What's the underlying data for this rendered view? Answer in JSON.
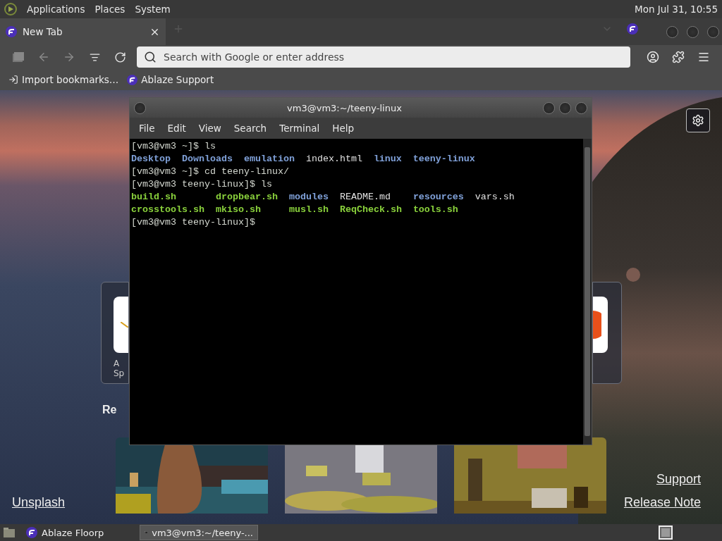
{
  "top_panel": {
    "menus": [
      "Applications",
      "Places",
      "System"
    ],
    "clock": "Mon Jul 31, 10:55"
  },
  "browser": {
    "tabs": [
      {
        "title": "New Tab",
        "selected": true
      }
    ],
    "address_bar": {
      "placeholder": "Search with Google or enter address"
    },
    "bookmarks": [
      {
        "label": "Import bookmarks…",
        "kind": "import"
      },
      {
        "label": "Ablaze Support",
        "kind": "site"
      }
    ]
  },
  "new_tab_page": {
    "shortcuts": [
      {
        "kind": "pen",
        "label_lines": [
          "A",
          "Sp"
        ]
      },
      {
        "kind": "orange"
      }
    ],
    "section_heading": "Re",
    "photos": [
      {
        "kind": "dog"
      },
      {
        "kind": "plates"
      },
      {
        "kind": "room"
      }
    ],
    "links_left": [
      "Unsplash"
    ],
    "links_right": [
      "Support",
      "Release Note"
    ]
  },
  "terminal": {
    "title": "vm3@vm3:~/teeny-linux",
    "menu": [
      "File",
      "Edit",
      "View",
      "Search",
      "Terminal",
      "Help"
    ],
    "lines": [
      {
        "kind": "command",
        "text": "[vm3@vm3 ~]$ ls"
      },
      {
        "kind": "listing",
        "rows": [
          [
            {
              "name": "Desktop",
              "kind": "dir"
            },
            {
              "name": "Downloads",
              "kind": "dir"
            },
            {
              "name": "emulation",
              "kind": "dir"
            },
            {
              "name": "index.html",
              "kind": "file"
            },
            {
              "name": "linux",
              "kind": "dir"
            },
            {
              "name": "teeny-linux",
              "kind": "dir"
            }
          ]
        ]
      },
      {
        "kind": "command",
        "text": "[vm3@vm3 ~]$ cd teeny-linux/"
      },
      {
        "kind": "command",
        "text": "[vm3@vm3 teeny-linux]$ ls"
      },
      {
        "kind": "listing",
        "rows": [
          [
            {
              "name": "build.sh",
              "kind": "exec"
            },
            {
              "name": "dropbear.sh",
              "kind": "exec"
            },
            {
              "name": "modules",
              "kind": "dir"
            },
            {
              "name": "README.md",
              "kind": "file"
            },
            {
              "name": "resources",
              "kind": "dir"
            },
            {
              "name": "vars.sh",
              "kind": "file"
            }
          ],
          [
            {
              "name": "crosstools.sh",
              "kind": "exec"
            },
            {
              "name": "mkiso.sh",
              "kind": "exec"
            },
            {
              "name": "musl.sh",
              "kind": "exec"
            },
            {
              "name": "ReqCheck.sh",
              "kind": "exec"
            },
            {
              "name": "tools.sh",
              "kind": "exec"
            }
          ]
        ]
      },
      {
        "kind": "command",
        "text": "[vm3@vm3 teeny-linux]$"
      }
    ]
  },
  "taskbar": {
    "tasks": [
      {
        "label": "Ablaze Floorp",
        "kind": "browser",
        "selected": false
      },
      {
        "label": "vm3@vm3:~/teeny-...",
        "kind": "terminal",
        "selected": true
      }
    ]
  }
}
